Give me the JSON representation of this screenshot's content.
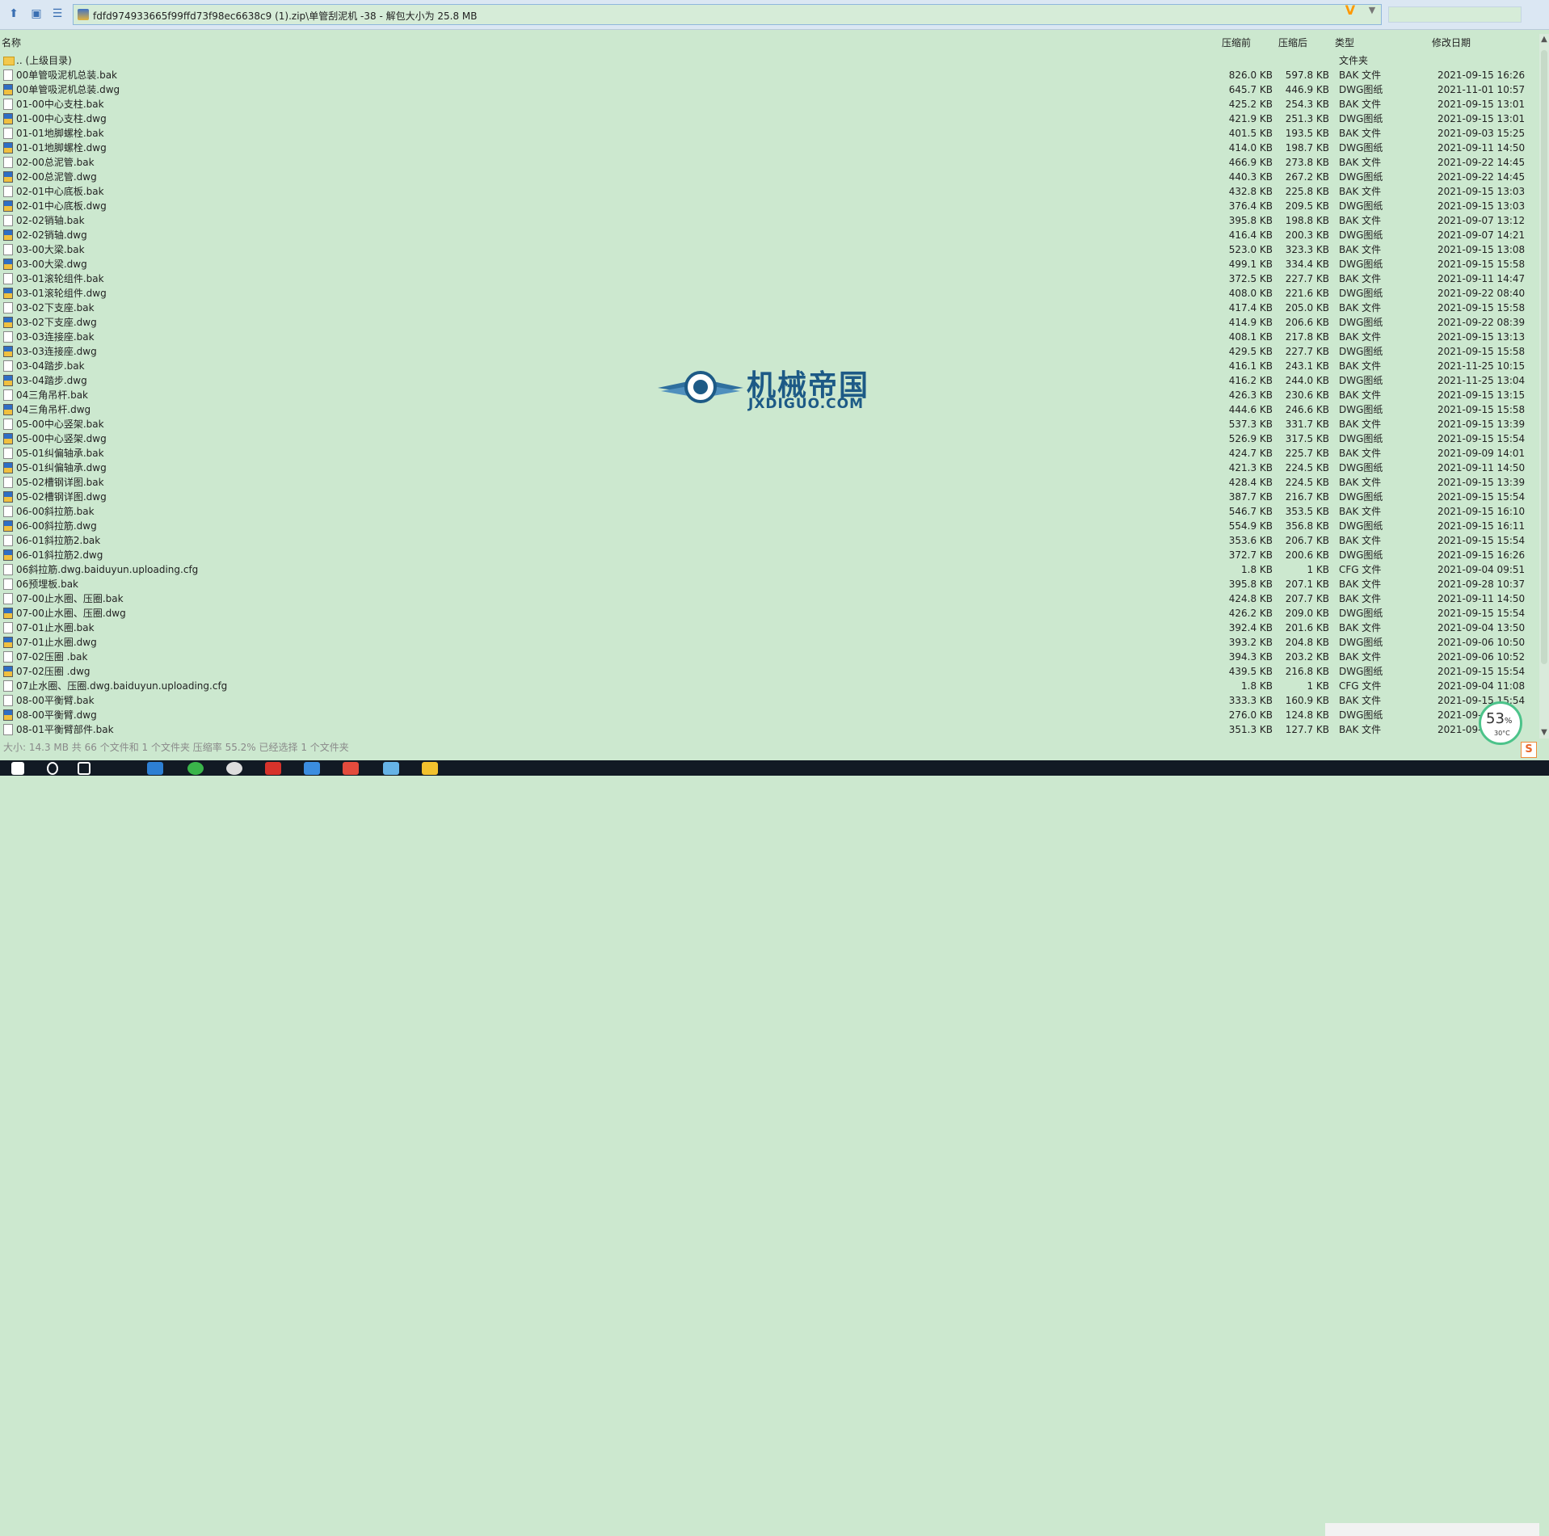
{
  "toolbar": {
    "back_icon": "up-arrow-icon",
    "view_icon": "view-icon",
    "list_icon": "list-icon",
    "address": "fdfd974933665f99ffd73f98ec6638c9 (1).zip\\单管刮泥机 -38 - 解包大小为 25.8 MB",
    "v_badge": "V"
  },
  "columns": {
    "name": "名称",
    "before": "压缩前",
    "after": "压缩后",
    "type": "类型",
    "date": "修改日期"
  },
  "parent_row": {
    "name": ".. (上级目录)",
    "type": "文件夹"
  },
  "files": [
    {
      "name": "00单管吸泥机总装.bak",
      "icon": "bak",
      "before": "826.0 KB",
      "after": "597.8 KB",
      "type": "BAK 文件",
      "date": "2021-09-15 16:26"
    },
    {
      "name": "00单管吸泥机总装.dwg",
      "icon": "dwg",
      "before": "645.7 KB",
      "after": "446.9 KB",
      "type": "DWG图纸",
      "date": "2021-11-01 10:57"
    },
    {
      "name": "01-00中心支柱.bak",
      "icon": "bak",
      "before": "425.2 KB",
      "after": "254.3 KB",
      "type": "BAK 文件",
      "date": "2021-09-15 13:01"
    },
    {
      "name": "01-00中心支柱.dwg",
      "icon": "dwg",
      "before": "421.9 KB",
      "after": "251.3 KB",
      "type": "DWG图纸",
      "date": "2021-09-15 13:01"
    },
    {
      "name": "01-01地脚螺栓.bak",
      "icon": "bak",
      "before": "401.5 KB",
      "after": "193.5 KB",
      "type": "BAK 文件",
      "date": "2021-09-03 15:25"
    },
    {
      "name": "01-01地脚螺栓.dwg",
      "icon": "dwg",
      "before": "414.0 KB",
      "after": "198.7 KB",
      "type": "DWG图纸",
      "date": "2021-09-11 14:50"
    },
    {
      "name": "02-00总泥管.bak",
      "icon": "bak",
      "before": "466.9 KB",
      "after": "273.8 KB",
      "type": "BAK 文件",
      "date": "2021-09-22 14:45"
    },
    {
      "name": "02-00总泥管.dwg",
      "icon": "dwg",
      "before": "440.3 KB",
      "after": "267.2 KB",
      "type": "DWG图纸",
      "date": "2021-09-22 14:45"
    },
    {
      "name": "02-01中心底板.bak",
      "icon": "bak",
      "before": "432.8 KB",
      "after": "225.8 KB",
      "type": "BAK 文件",
      "date": "2021-09-15 13:03"
    },
    {
      "name": "02-01中心底板.dwg",
      "icon": "dwg",
      "before": "376.4 KB",
      "after": "209.5 KB",
      "type": "DWG图纸",
      "date": "2021-09-15 13:03"
    },
    {
      "name": "02-02销轴.bak",
      "icon": "bak",
      "before": "395.8 KB",
      "after": "198.8 KB",
      "type": "BAK 文件",
      "date": "2021-09-07 13:12"
    },
    {
      "name": "02-02销轴.dwg",
      "icon": "dwg",
      "before": "416.4 KB",
      "after": "200.3 KB",
      "type": "DWG图纸",
      "date": "2021-09-07 14:21"
    },
    {
      "name": "03-00大梁.bak",
      "icon": "bak",
      "before": "523.0 KB",
      "after": "323.3 KB",
      "type": "BAK 文件",
      "date": "2021-09-15 13:08"
    },
    {
      "name": "03-00大梁.dwg",
      "icon": "dwg",
      "before": "499.1 KB",
      "after": "334.4 KB",
      "type": "DWG图纸",
      "date": "2021-09-15 15:58"
    },
    {
      "name": "03-01滚轮组件.bak",
      "icon": "bak",
      "before": "372.5 KB",
      "after": "227.7 KB",
      "type": "BAK 文件",
      "date": "2021-09-11 14:47"
    },
    {
      "name": "03-01滚轮组件.dwg",
      "icon": "dwg",
      "before": "408.0 KB",
      "after": "221.6 KB",
      "type": "DWG图纸",
      "date": "2021-09-22 08:40"
    },
    {
      "name": "03-02下支座.bak",
      "icon": "bak",
      "before": "417.4 KB",
      "after": "205.0 KB",
      "type": "BAK 文件",
      "date": "2021-09-15 15:58"
    },
    {
      "name": "03-02下支座.dwg",
      "icon": "dwg",
      "before": "414.9 KB",
      "after": "206.6 KB",
      "type": "DWG图纸",
      "date": "2021-09-22 08:39"
    },
    {
      "name": "03-03连接座.bak",
      "icon": "bak",
      "before": "408.1 KB",
      "after": "217.8 KB",
      "type": "BAK 文件",
      "date": "2021-09-15 13:13"
    },
    {
      "name": "03-03连接座.dwg",
      "icon": "dwg",
      "before": "429.5 KB",
      "after": "227.7 KB",
      "type": "DWG图纸",
      "date": "2021-09-15 15:58"
    },
    {
      "name": "03-04踏步.bak",
      "icon": "bak",
      "before": "416.1 KB",
      "after": "243.1 KB",
      "type": "BAK 文件",
      "date": "2021-11-25 10:15"
    },
    {
      "name": "03-04踏步.dwg",
      "icon": "dwg",
      "before": "416.2 KB",
      "after": "244.0 KB",
      "type": "DWG图纸",
      "date": "2021-11-25 13:04"
    },
    {
      "name": "04三角吊杆.bak",
      "icon": "bak",
      "before": "426.3 KB",
      "after": "230.6 KB",
      "type": "BAK 文件",
      "date": "2021-09-15 13:15"
    },
    {
      "name": "04三角吊杆.dwg",
      "icon": "dwg",
      "before": "444.6 KB",
      "after": "246.6 KB",
      "type": "DWG图纸",
      "date": "2021-09-15 15:58"
    },
    {
      "name": "05-00中心竖架.bak",
      "icon": "bak",
      "before": "537.3 KB",
      "after": "331.7 KB",
      "type": "BAK 文件",
      "date": "2021-09-15 13:39"
    },
    {
      "name": "05-00中心竖架.dwg",
      "icon": "dwg",
      "before": "526.9 KB",
      "after": "317.5 KB",
      "type": "DWG图纸",
      "date": "2021-09-15 15:54"
    },
    {
      "name": "05-01纠偏轴承.bak",
      "icon": "bak",
      "before": "424.7 KB",
      "after": "225.7 KB",
      "type": "BAK 文件",
      "date": "2021-09-09 14:01"
    },
    {
      "name": "05-01纠偏轴承.dwg",
      "icon": "dwg",
      "before": "421.3 KB",
      "after": "224.5 KB",
      "type": "DWG图纸",
      "date": "2021-09-11 14:50"
    },
    {
      "name": "05-02槽钢详图.bak",
      "icon": "bak",
      "before": "428.4 KB",
      "after": "224.5 KB",
      "type": "BAK 文件",
      "date": "2021-09-15 13:39"
    },
    {
      "name": "05-02槽钢详图.dwg",
      "icon": "dwg",
      "before": "387.7 KB",
      "after": "216.7 KB",
      "type": "DWG图纸",
      "date": "2021-09-15 15:54"
    },
    {
      "name": "06-00斜拉筋.bak",
      "icon": "bak",
      "before": "546.7 KB",
      "after": "353.5 KB",
      "type": "BAK 文件",
      "date": "2021-09-15 16:10"
    },
    {
      "name": "06-00斜拉筋.dwg",
      "icon": "dwg",
      "before": "554.9 KB",
      "after": "356.8 KB",
      "type": "DWG图纸",
      "date": "2021-09-15 16:11"
    },
    {
      "name": "06-01斜拉筋2.bak",
      "icon": "bak",
      "before": "353.6 KB",
      "after": "206.7 KB",
      "type": "BAK 文件",
      "date": "2021-09-15 15:54"
    },
    {
      "name": "06-01斜拉筋2.dwg",
      "icon": "dwg",
      "before": "372.7 KB",
      "after": "200.6 KB",
      "type": "DWG图纸",
      "date": "2021-09-15 16:26"
    },
    {
      "name": "06斜拉筋.dwg.baiduyun.uploading.cfg",
      "icon": "cfg",
      "before": "1.8 KB",
      "after": "1 KB",
      "type": "CFG 文件",
      "date": "2021-09-04 09:51"
    },
    {
      "name": "06预埋板.bak",
      "icon": "bak",
      "before": "395.8 KB",
      "after": "207.1 KB",
      "type": "BAK 文件",
      "date": "2021-09-28 10:37"
    },
    {
      "name": "07-00止水圈、压圈.bak",
      "icon": "bak",
      "before": "424.8 KB",
      "after": "207.7 KB",
      "type": "BAK 文件",
      "date": "2021-09-11 14:50"
    },
    {
      "name": "07-00止水圈、压圈.dwg",
      "icon": "dwg",
      "before": "426.2 KB",
      "after": "209.0 KB",
      "type": "DWG图纸",
      "date": "2021-09-15 15:54"
    },
    {
      "name": "07-01止水圈.bak",
      "icon": "bak",
      "before": "392.4 KB",
      "after": "201.6 KB",
      "type": "BAK 文件",
      "date": "2021-09-04 13:50"
    },
    {
      "name": "07-01止水圈.dwg",
      "icon": "dwg",
      "before": "393.2 KB",
      "after": "204.8 KB",
      "type": "DWG图纸",
      "date": "2021-09-06 10:50"
    },
    {
      "name": "07-02压圈 .bak",
      "icon": "bak",
      "before": "394.3 KB",
      "after": "203.2 KB",
      "type": "BAK 文件",
      "date": "2021-09-06 10:52"
    },
    {
      "name": "07-02压圈 .dwg",
      "icon": "dwg",
      "before": "439.5 KB",
      "after": "216.8 KB",
      "type": "DWG图纸",
      "date": "2021-09-15 15:54"
    },
    {
      "name": "07止水圈、压圈.dwg.baiduyun.uploading.cfg",
      "icon": "cfg",
      "before": "1.8 KB",
      "after": "1 KB",
      "type": "CFG 文件",
      "date": "2021-09-04 11:08"
    },
    {
      "name": "08-00平衡臂.bak",
      "icon": "bak",
      "before": "333.3 KB",
      "after": "160.9 KB",
      "type": "BAK 文件",
      "date": "2021-09-15 15:54"
    },
    {
      "name": "08-00平衡臂.dwg",
      "icon": "dwg",
      "before": "276.0 KB",
      "after": "124.8 KB",
      "type": "DWG图纸",
      "date": "2021-09-1"
    },
    {
      "name": "08-01平衡臂部件.bak",
      "icon": "bak",
      "before": "351.3 KB",
      "after": "127.7 KB",
      "type": "BAK 文件",
      "date": "2021-09-"
    }
  ],
  "status_bar": "大小: 14.3 MB 共 66 个文件和 1 个文件夹 压缩率 55.2% 已经选择 1 个文件夹",
  "watermark": {
    "title": "机械帝国",
    "subtitle": "JXDIGUO.COM"
  },
  "speed_widget": {
    "percent": "53",
    "percent_sign": "%",
    "temp": "30°C"
  },
  "colors": {
    "background": "#cce8cf",
    "toolbar": "#dbe7f3",
    "accent": "#1d5a86"
  }
}
